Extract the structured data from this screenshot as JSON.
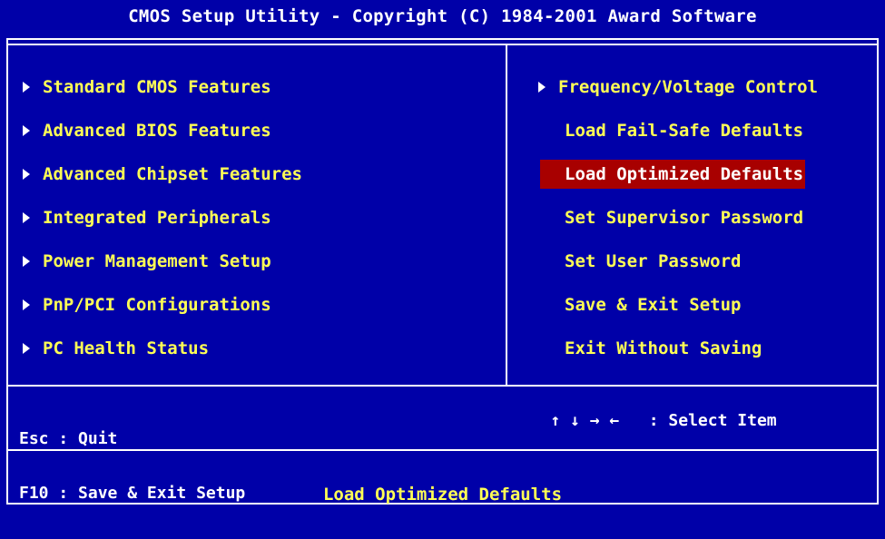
{
  "title": "CMOS Setup Utility - Copyright (C) 1984-2001 Award Software",
  "left_menu": [
    {
      "label": "Standard CMOS Features",
      "has_submenu": true
    },
    {
      "label": "Advanced BIOS Features",
      "has_submenu": true
    },
    {
      "label": "Advanced Chipset Features",
      "has_submenu": true
    },
    {
      "label": "Integrated Peripherals",
      "has_submenu": true
    },
    {
      "label": "Power Management Setup",
      "has_submenu": true
    },
    {
      "label": "PnP/PCI Configurations",
      "has_submenu": true
    },
    {
      "label": "PC Health Status",
      "has_submenu": true
    }
  ],
  "right_menu": [
    {
      "label": "Frequency/Voltage Control",
      "has_submenu": true
    },
    {
      "label": "Load Fail-Safe Defaults",
      "has_submenu": false
    },
    {
      "label": "Load Optimized Defaults",
      "has_submenu": false,
      "selected": true
    },
    {
      "label": "Set Supervisor Password",
      "has_submenu": false
    },
    {
      "label": "Set User Password",
      "has_submenu": false
    },
    {
      "label": "Save & Exit Setup",
      "has_submenu": false
    },
    {
      "label": "Exit Without Saving",
      "has_submenu": false
    }
  ],
  "help": {
    "esc_key": "Esc",
    "esc_action": "Quit",
    "f10_key": "F10",
    "f10_action": "Save & Exit Setup",
    "arrow_keys": "↑ ↓ → ←",
    "arrow_action": "Select Item"
  },
  "status": "Load Optimized Defaults",
  "colors": {
    "background": "#0000a8",
    "item_text": "#ffff55",
    "selection_bg": "#a80000",
    "frame": "#ffffff"
  }
}
